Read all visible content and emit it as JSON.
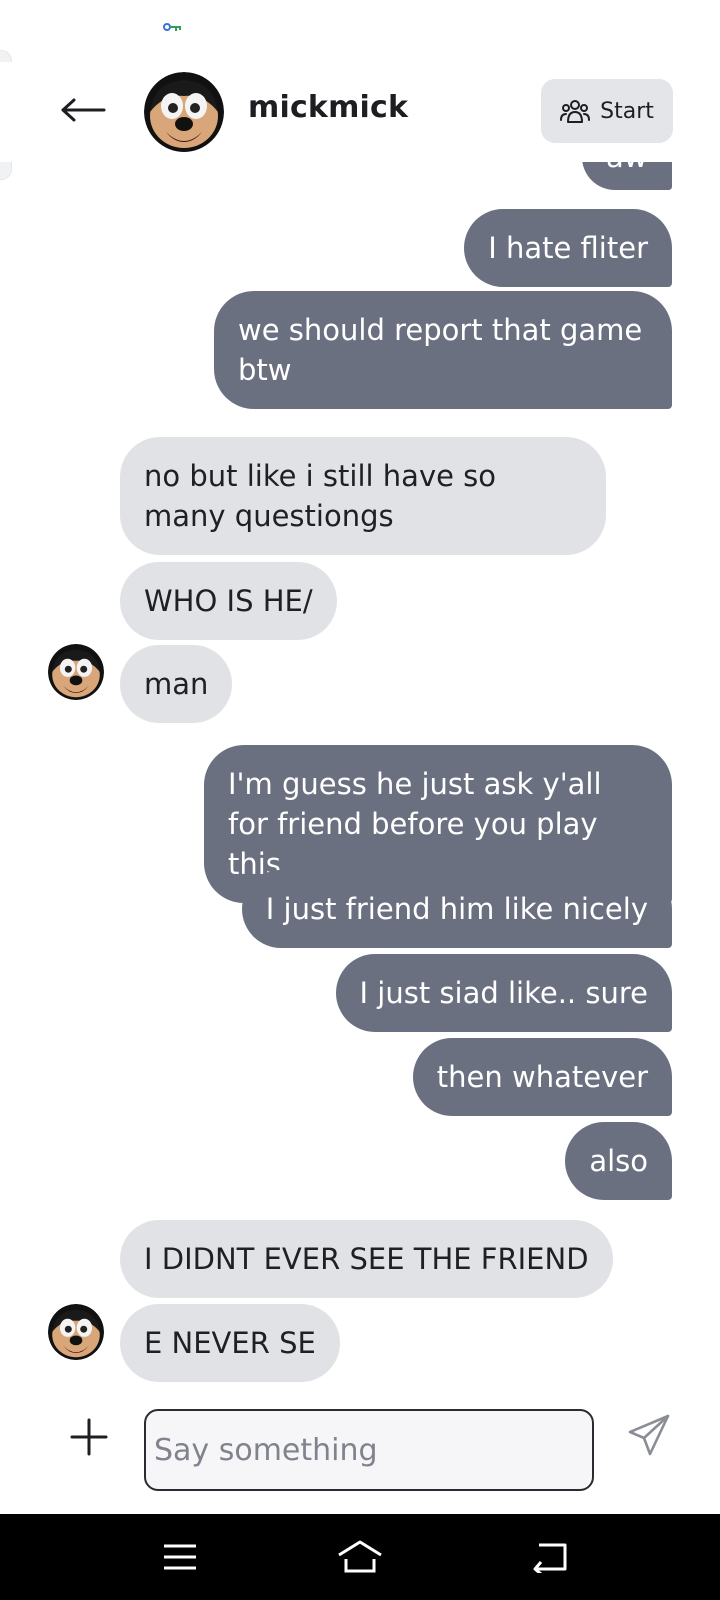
{
  "header": {
    "username": "mickmick",
    "start_label": "Start"
  },
  "messages": [
    {
      "dir": "out",
      "text": "aw"
    },
    {
      "dir": "out",
      "text": "I hate fliter"
    },
    {
      "dir": "out",
      "text": "we should report that game btw"
    },
    {
      "dir": "in",
      "text": "no but like i still have so many questiongs"
    },
    {
      "dir": "in",
      "text": "WHO IS HE/"
    },
    {
      "dir": "in",
      "text": "man"
    },
    {
      "dir": "out",
      "text": "I'm guess he just ask y'all for friend before you play this"
    },
    {
      "dir": "out",
      "text": "I just friend him like nicely"
    },
    {
      "dir": "out",
      "text": "I just siad like.. sure"
    },
    {
      "dir": "out",
      "text": "then whatever"
    },
    {
      "dir": "out",
      "text": "also"
    },
    {
      "dir": "in",
      "text": "I DIDNT EVER SEE THE FRIEND"
    },
    {
      "dir": "in",
      "text": "E NEVER SE"
    }
  ],
  "composer": {
    "placeholder": "Say something"
  },
  "icons": {
    "back": "arrow-left-icon",
    "start": "people-group-icon",
    "plus": "plus-icon",
    "send": "paper-plane-icon",
    "nav_menu": "menu-icon",
    "nav_home": "home-icon",
    "nav_back": "back-icon"
  },
  "colors": {
    "outgoing_bubble": "#6b7080",
    "incoming_bubble": "#e1e2e6",
    "start_button": "#e4e5e8"
  }
}
